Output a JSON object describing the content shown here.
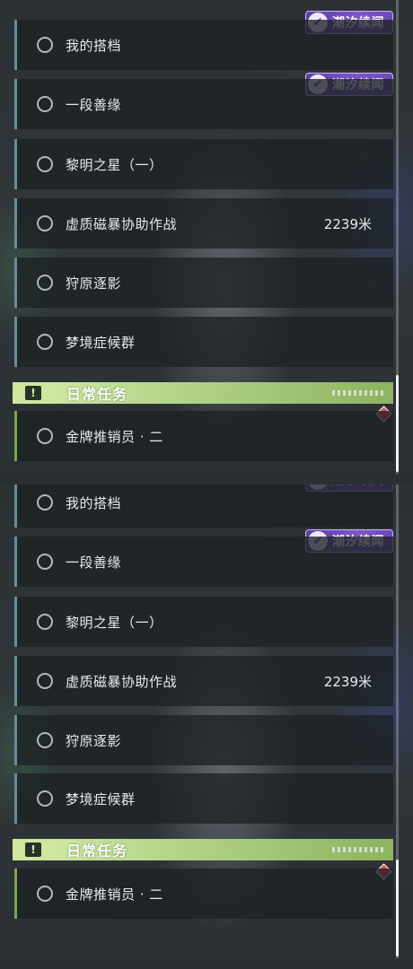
{
  "badge_text": "潮汐续闻",
  "badge_logo": "✔",
  "quests": [
    {
      "label": "我的搭档",
      "distance": ""
    },
    {
      "label": "一段善缘",
      "distance": ""
    },
    {
      "label": "黎明之星（一）",
      "distance": ""
    },
    {
      "label": "虚质磁暴协助作战",
      "distance": "2239米"
    },
    {
      "label": "狩原逐影",
      "distance": ""
    },
    {
      "label": "梦境症候群",
      "distance": ""
    }
  ],
  "daily": {
    "header": "日常任务",
    "icon_glyph": "!",
    "quest_label": "金牌推销员 · 二"
  },
  "colors": {
    "badge": "#7c56c9",
    "daily_header": "#b6d68a",
    "marker": "#e04b5c"
  },
  "icons": [
    "quest-circle-icon",
    "tidal-logo-icon",
    "exclamation-icon",
    "diamond-marker-icon"
  ]
}
